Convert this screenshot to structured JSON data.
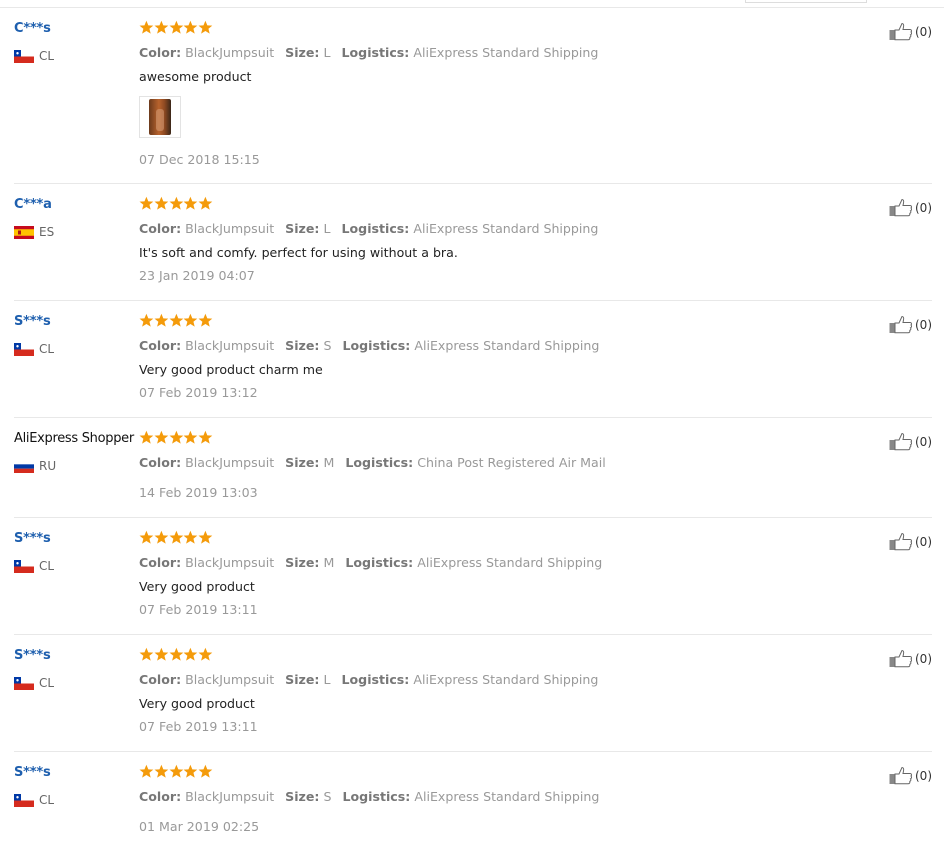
{
  "labels": {
    "color": "Color:",
    "size": "Size:",
    "logistics": "Logistics:"
  },
  "rating_color": "#f49b0b",
  "reviews": [
    {
      "user": "C***s",
      "country": "CL",
      "flag": "chile-flag-icon",
      "stars": 5,
      "color": "BlackJumpsuit",
      "size": "L",
      "logistics": "AliExpress Standard Shipping",
      "text": "awesome product",
      "date": "07 Dec 2018 15:15",
      "has_photo": true,
      "likes": "(0)"
    },
    {
      "user": "C***a",
      "country": "ES",
      "flag": "spain-flag-icon",
      "stars": 5,
      "color": "BlackJumpsuit",
      "size": "L",
      "logistics": "AliExpress Standard Shipping",
      "text": "It's soft and comfy. perfect for using without a bra.",
      "date": "23 Jan 2019 04:07",
      "has_photo": false,
      "likes": "(0)"
    },
    {
      "user": "S***s",
      "country": "CL",
      "flag": "chile-flag-icon",
      "stars": 5,
      "color": "BlackJumpsuit",
      "size": "S",
      "logistics": "AliExpress Standard Shipping",
      "text": "Very good product charm me",
      "date": "07 Feb 2019 13:12",
      "has_photo": false,
      "likes": "(0)"
    },
    {
      "user": "AliExpress Shopper",
      "country": "RU",
      "flag": "russia-flag-icon",
      "stars": 5,
      "color": "BlackJumpsuit",
      "size": "M",
      "logistics": "China Post Registered Air Mail",
      "text": "",
      "date": "14 Feb 2019 13:03",
      "has_photo": false,
      "likes": "(0)"
    },
    {
      "user": "S***s",
      "country": "CL",
      "flag": "chile-flag-icon",
      "stars": 5,
      "color": "BlackJumpsuit",
      "size": "M",
      "logistics": "AliExpress Standard Shipping",
      "text": "Very good product",
      "date": "07 Feb 2019 13:11",
      "has_photo": false,
      "likes": "(0)"
    },
    {
      "user": "S***s",
      "country": "CL",
      "flag": "chile-flag-icon",
      "stars": 5,
      "color": "BlackJumpsuit",
      "size": "L",
      "logistics": "AliExpress Standard Shipping",
      "text": "Very good product",
      "date": "07 Feb 2019 13:11",
      "has_photo": false,
      "likes": "(0)"
    },
    {
      "user": "S***s",
      "country": "CL",
      "flag": "chile-flag-icon",
      "stars": 5,
      "color": "BlackJumpsuit",
      "size": "S",
      "logistics": "AliExpress Standard Shipping",
      "text": "",
      "date": "01 Mar 2019 02:25",
      "has_photo": false,
      "likes": "(0)"
    }
  ]
}
